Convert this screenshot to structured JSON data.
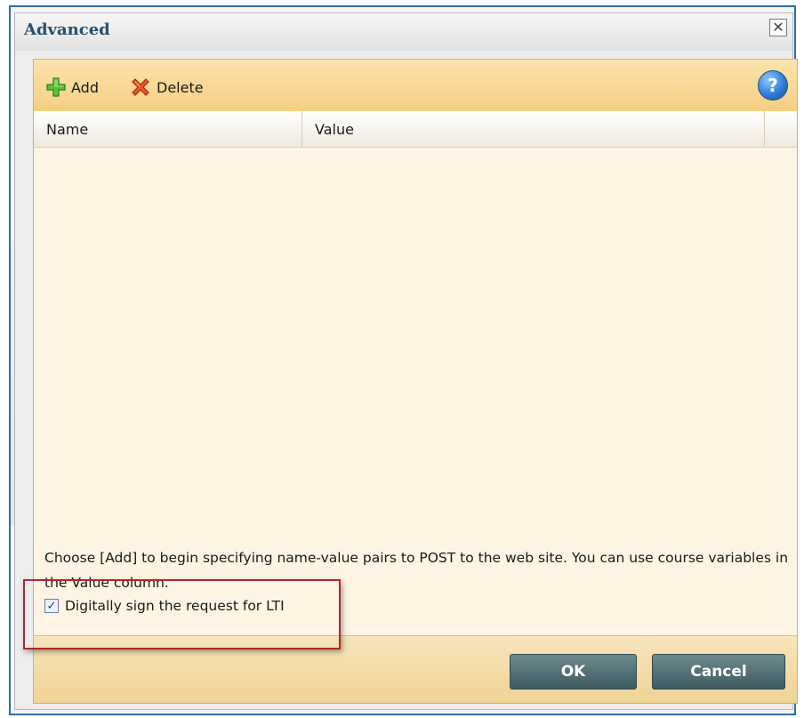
{
  "dialog": {
    "title": "Advanced",
    "close_glyph": "✕"
  },
  "toolbar": {
    "add_label": "Add",
    "add_icon": "plus-icon",
    "delete_label": "Delete",
    "delete_icon": "x-icon",
    "help_glyph": "?",
    "help_icon": "help-icon"
  },
  "grid": {
    "columns": [
      "Name",
      "Value"
    ],
    "rows": []
  },
  "instructions": "Choose [Add] to begin specifying name-value pairs to POST to the web site. You can use course variables in the Value column.",
  "sign_option": {
    "label": "Digitally sign the request for LTI",
    "checked": true
  },
  "footer": {
    "ok_label": "OK",
    "cancel_label": "Cancel"
  },
  "colors": {
    "toolbar": "#f4cf82",
    "panel": "#fdf4e3",
    "button": "#4f6b71",
    "highlight": "#b0282c"
  }
}
